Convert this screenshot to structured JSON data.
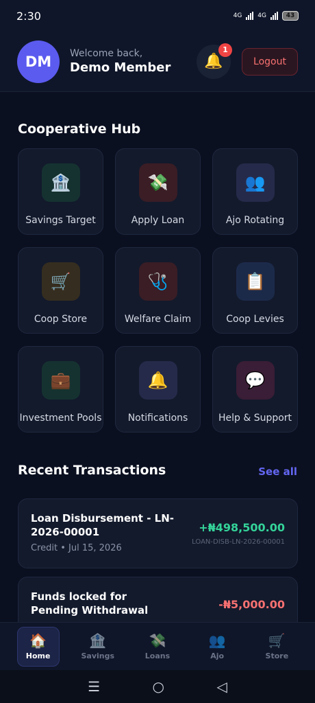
{
  "status_bar": {
    "time": "2:30",
    "net1": "4G",
    "net2": "4G",
    "battery": "43"
  },
  "header": {
    "avatar_initials": "DM",
    "welcome": "Welcome back,",
    "name": "Demo Member",
    "notification_count": "1",
    "logout_label": "Logout"
  },
  "hub": {
    "title": "Cooperative Hub",
    "items": [
      {
        "label": "Savings Target",
        "icon": "🏦",
        "icon_name": "bank-icon",
        "bg": "#153230"
      },
      {
        "label": "Apply Loan",
        "icon": "💸",
        "icon_name": "money-wings-icon",
        "bg": "#3a1d25"
      },
      {
        "label": "Ajo Rotating",
        "icon": "👥",
        "icon_name": "users-icon",
        "bg": "#262a4a"
      },
      {
        "label": "Coop Store",
        "icon": "🛒",
        "icon_name": "cart-icon",
        "bg": "#352d1f"
      },
      {
        "label": "Welfare Claim",
        "icon": "🩺",
        "icon_name": "stethoscope-icon",
        "bg": "#3a1d25"
      },
      {
        "label": "Coop Levies",
        "icon": "📋",
        "icon_name": "clipboard-icon",
        "bg": "#1c2a4a"
      },
      {
        "label": "Investment Pools",
        "icon": "💼",
        "icon_name": "briefcase-icon",
        "bg": "#153230"
      },
      {
        "label": "Notifications",
        "icon": "🔔",
        "icon_name": "bell-icon",
        "bg": "#262a4a"
      },
      {
        "label": "Help & Support",
        "icon": "💬",
        "icon_name": "chat-icon",
        "bg": "#3a1d36"
      }
    ]
  },
  "transactions": {
    "title": "Recent Transactions",
    "see_all": "See all",
    "items": [
      {
        "name": "Loan Disbursement - LN-2026-00001",
        "meta": "Credit • Jul 15, 2026",
        "amount": "+₦498,500.00",
        "ref": "LOAN-DISB-LN-2026-00001"
      },
      {
        "name": "Funds locked for Pending Withdrawal",
        "amount": "-₦5,000.00"
      }
    ]
  },
  "bottom_nav": {
    "items": [
      {
        "label": "Home",
        "icon": "🏠",
        "icon_name": "home-icon",
        "active": true
      },
      {
        "label": "Savings",
        "icon": "🏦",
        "icon_name": "bank-icon",
        "active": false
      },
      {
        "label": "Loans",
        "icon": "💸",
        "icon_name": "money-wings-icon",
        "active": false
      },
      {
        "label": "Ajo",
        "icon": "👥",
        "icon_name": "users-icon",
        "active": false
      },
      {
        "label": "Store",
        "icon": "🛒",
        "icon_name": "cart-icon",
        "active": false
      }
    ]
  },
  "system_nav": {
    "menu_icon": "☰",
    "home_icon": "○",
    "back_icon": "◁"
  },
  "colors": {
    "accent": "#6366f1",
    "positive": "#34d399",
    "negative": "#f87171",
    "background": "#0b1020"
  }
}
